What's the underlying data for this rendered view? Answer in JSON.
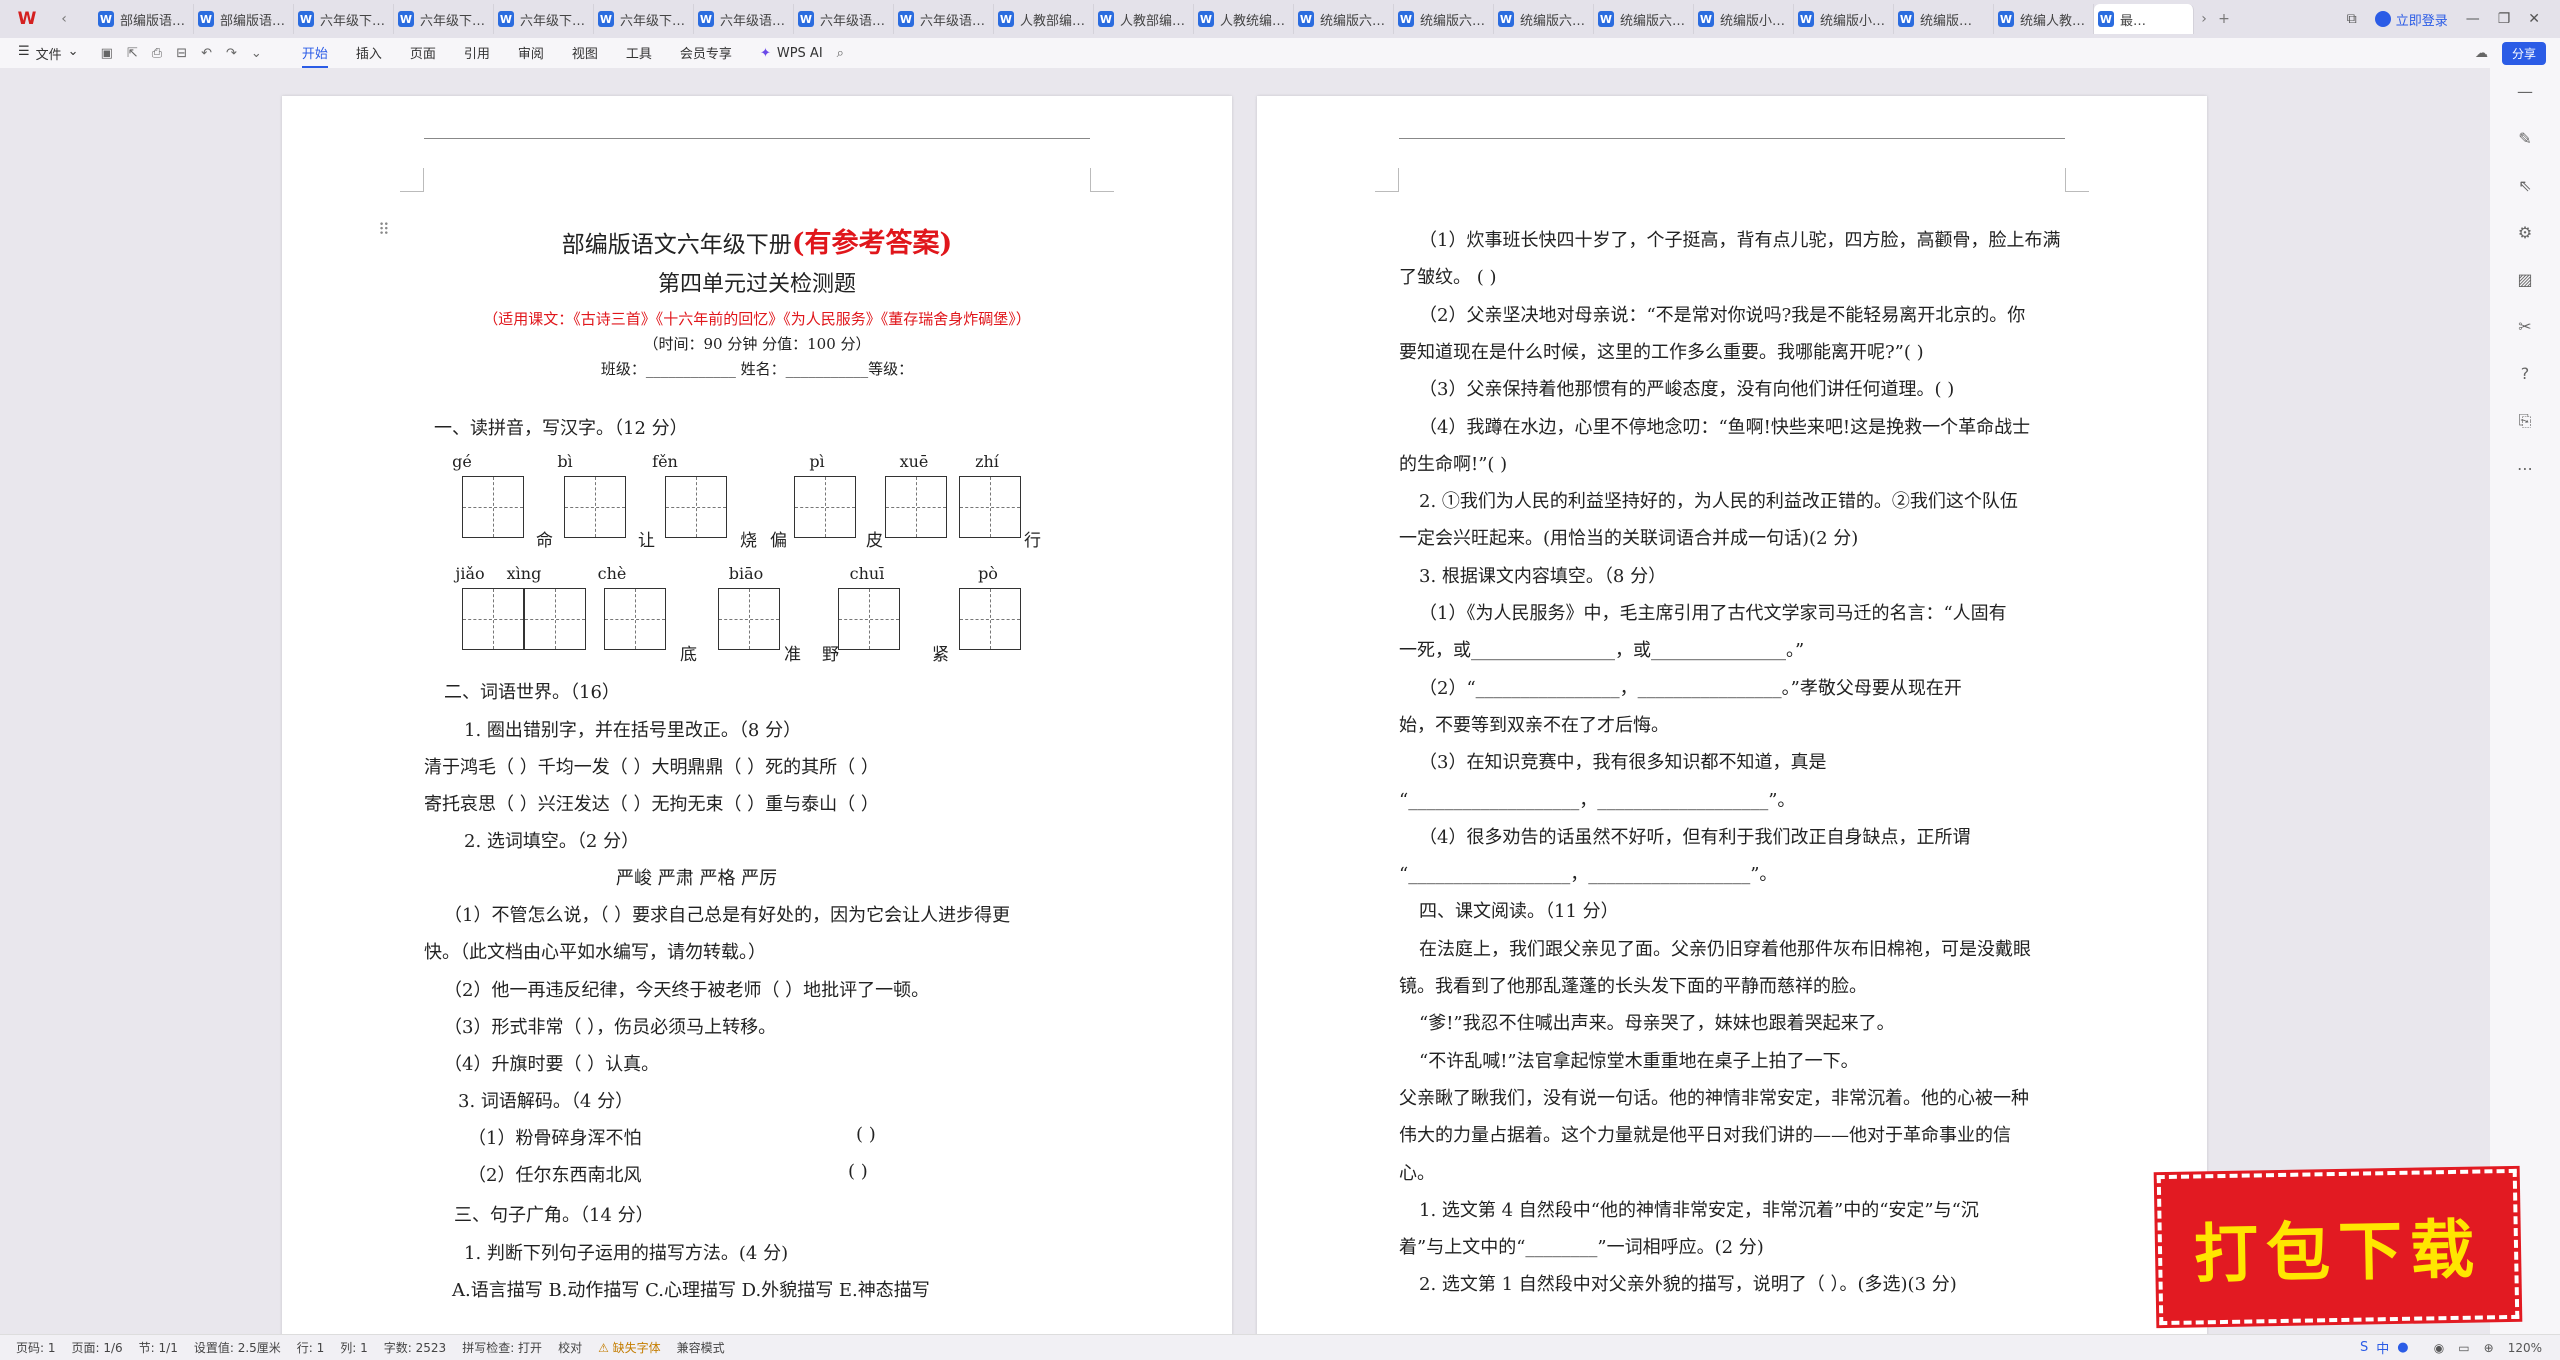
{
  "tabs": [
    "部编版语…",
    "部编版语…",
    "六年级下…",
    "六年级下…",
    "六年级下…",
    "六年级下…",
    "六年级语…",
    "六年级语…",
    "六年级语…",
    "人教部编…",
    "人教部编…",
    "人教统编…",
    "统编版六…",
    "统编版六…",
    "统编版六…",
    "统编版六…",
    "统编版小…",
    "统编版小…",
    "统编版…",
    "统编人教…",
    "最…"
  ],
  "tabbar": {
    "login": "立即登录"
  },
  "menu": {
    "file": "文件",
    "tabs": [
      "开始",
      "插入",
      "页面",
      "引用",
      "审阅",
      "视图",
      "工具",
      "会员专享"
    ],
    "ai": "WPS AI",
    "share": "分享"
  },
  "page1": {
    "title": "部编版语文六年级下册",
    "title_red": "(有参考答案)",
    "subtitle": "第四单元过关检测题",
    "lessons": "（适用课文：《古诗三首》《十六年前的回忆》《为人民服务》《董存瑞舍身炸碉堡》）",
    "time": "（时间：90 分钟   分值：100 分）",
    "classline": "班级：____________    姓名：___________等级：",
    "s1": "一、读拼音，写汉字。（12 分）",
    "pinyin1": [
      "gé",
      "bì",
      "fěn",
      "pì",
      "xuē",
      "zhí"
    ],
    "chars1": [
      "命",
      "让",
      "烧",
      "偏",
      "皮",
      "行"
    ],
    "pinyin2": [
      "jiǎo",
      "xìng",
      "chè",
      "biāo",
      "chuī",
      "pò"
    ],
    "chars2": [
      "底",
      "准",
      "野",
      "紧"
    ],
    "s2": "二、词语世界。（16）",
    "q21": "1. 圈出错别字，并在括号里改正。（8 分）",
    "q21a": "清于鸿毛（      ）千均一发（      ）大明鼎鼎（      ）死的其所（      ）",
    "q21b": "寄托哀思（      ）兴汪发达（      ）无拘无束（      ）重与泰山（      ）",
    "q22": "2. 选词填空。（2 分）",
    "words": "严峻  严肃    严格     严厉",
    "q22a": "（1）不管怎么说，（      ）要求自己总是有好处的，因为它会让人进步得更",
    "q22a2": "快。（此文档由心平如水编写，请勿转载。）",
    "q22b": "（2）他一再违反纪律，今天终于被老师（        ）地批评了一顿。",
    "q22c": "（3）形式非常（        ），伤员必须马上转移。",
    "q22d": "（4）升旗时要（        ）认真。",
    "q23": "3. 词语解码。（4 分）",
    "q23a": "（1）粉骨碎身浑不怕",
    "q23b": "（2）任尔东西南北风",
    "paren": "(                              )",
    "s3": "三、句子广角。（14 分）",
    "q31": "1. 判断下列句子运用的描写方法。(4 分)",
    "q31opts": "A.语言描写   B.动作描写   C.心理描写   D.外貌描写   E.神态描写"
  },
  "page2": {
    "lines": [
      "（1）炊事班长快四十岁了，个子挺高，背有点儿驼，四方脸，高颧骨，脸上布满",
      "了皱纹。                                  (      )",
      "（2）父亲坚决地对母亲说：“不是常对你说吗?我是不能轻易离开北京的。你",
      "要知道现在是什么时候，这里的工作多么重要。我哪能离开呢?”(      )",
      "（3）父亲保持着他那惯有的严峻态度，没有向他们讲任何道理。(      )",
      "（4）我蹲在水边，心里不停地念叨：“鱼啊!快些来吧!这是挽救一个革命战士",
      "的生命啊!”(      )",
      "2. ①我们为人民的利益坚持好的，为人民的利益改正错的。②我们这个队伍",
      "一定会兴旺起来。(用恰当的关联词语合并成一句话)(2 分)",
      "3. 根据课文内容填空。（8 分）",
      "（1）《为人民服务》中，毛主席引用了古代文学家司马迁的名言：“人固有",
      "一死，或________________，或_______________。”",
      "（2）“________________，________________。”孝敬父母要从现在开",
      "始，不要等到双亲不在了才后悔。",
      "（3）在知识竞赛中，我有很多知识都不知道，真是",
      "“___________________，___________________”。",
      "（4）很多劝告的话虽然不好听，但有利于我们改正自身缺点，正所谓",
      "“__________________，__________________”。",
      "四、课文阅读。（11 分）",
      "在法庭上，我们跟父亲见了面。父亲仍旧穿着他那件灰布旧棉袍，可是没戴眼",
      "镜。我看到了他那乱蓬蓬的长头发下面的平静而慈祥的脸。",
      "“爹!”我忍不住喊出声来。母亲哭了，妹妹也跟着哭起来了。",
      "“不许乱喊!”法官拿起惊堂木重重地在桌子上拍了一下。",
      "父亲瞅了瞅我们，没有说一句话。他的神情非常安定，非常沉着。他的心被一种",
      "伟大的力量占据着。这个力量就是他平日对我们讲的——他对于革命事业的信",
      "心。",
      "1. 选文第 4 自然段中“他的神情非常安定，非常沉着”中的“安定”与“沉",
      "着”与上文中的“________”一词相呼应。(2 分)",
      "2. 选文第 1 自然段中对父亲外貌的描写，说明了（      ）。(多选)(3 分)"
    ]
  },
  "status": {
    "page": "页码: 1",
    "pages": "页面: 1/6",
    "section": "节: 1/1",
    "setting": "设置值: 2.5厘米",
    "row": "行: 1",
    "col": "列: 1",
    "words": "字数: 2523",
    "spell": "拼写检查: 打开",
    "proof": "校对",
    "font_missing": "缺失字体",
    "compat": "兼容模式",
    "zoom": "120%"
  },
  "banner": "打包下载"
}
